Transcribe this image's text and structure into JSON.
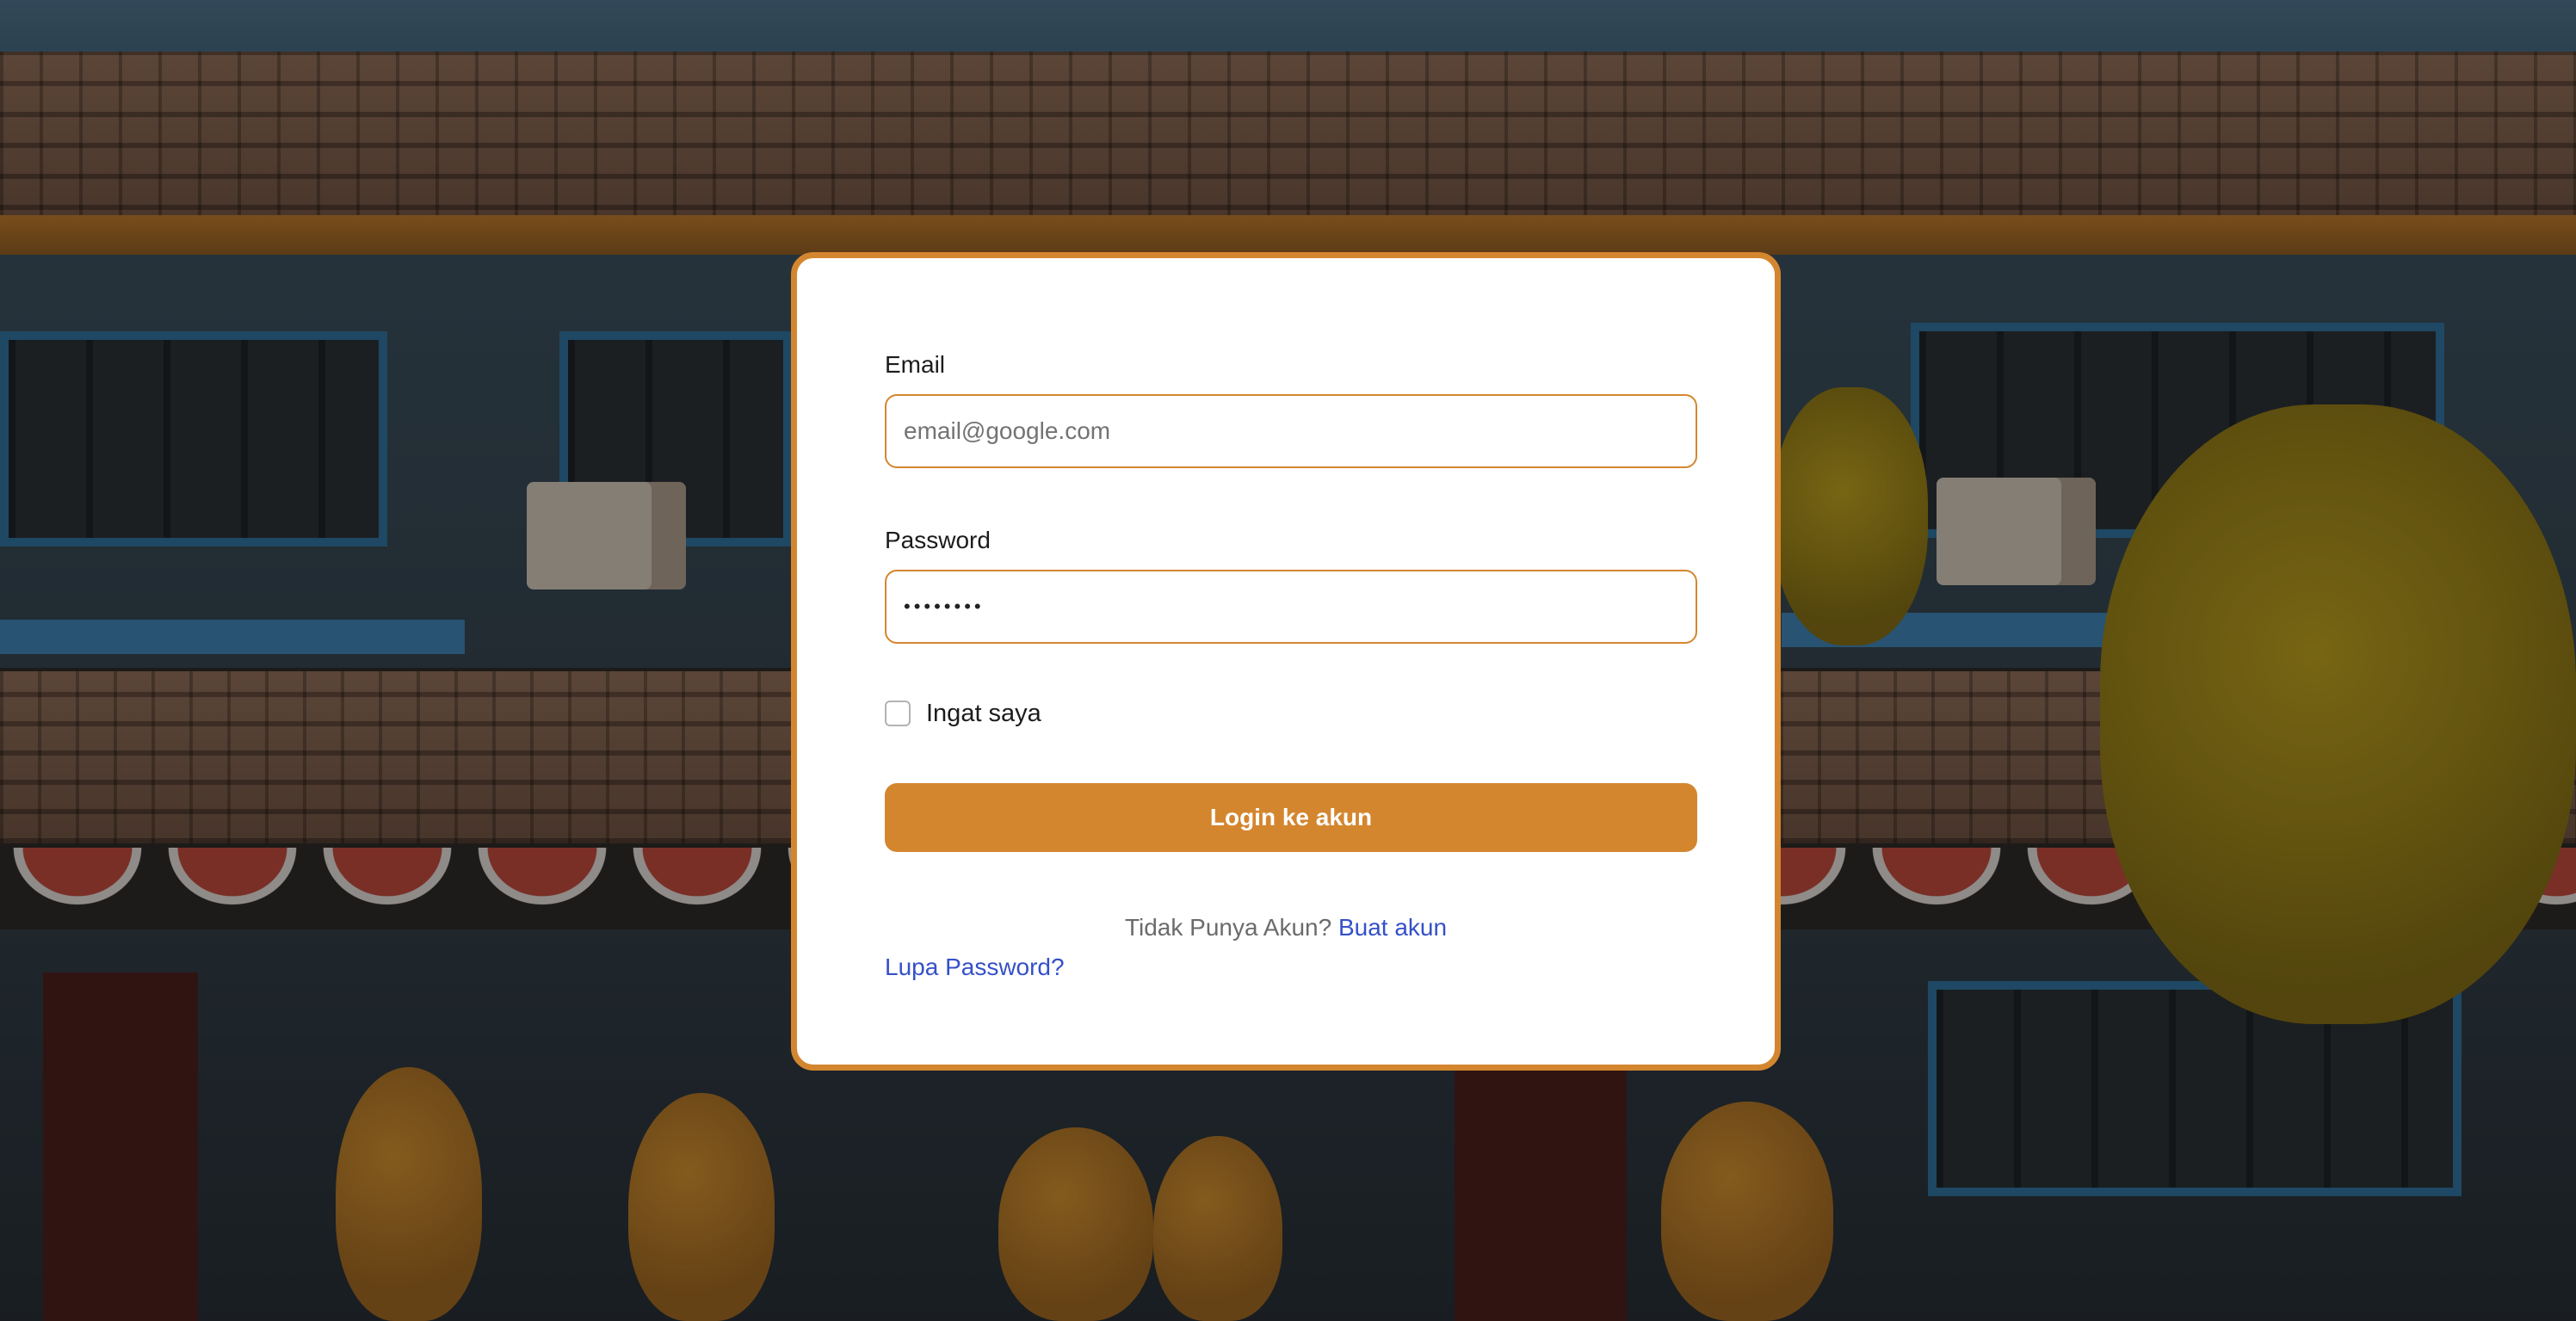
{
  "login": {
    "email_label": "Email",
    "email_placeholder": "email@google.com",
    "password_label": "Password",
    "password_value": "••••••••",
    "remember_label": "Ingat saya",
    "remember_checked": false,
    "submit_label": "Login ke akun",
    "no_account_text": "Tidak Punya Akun?",
    "signup_link": "Buat akun",
    "forgot_link": "Lupa Password?"
  },
  "colors": {
    "accent": "#d4862f",
    "link": "#3550c8"
  }
}
